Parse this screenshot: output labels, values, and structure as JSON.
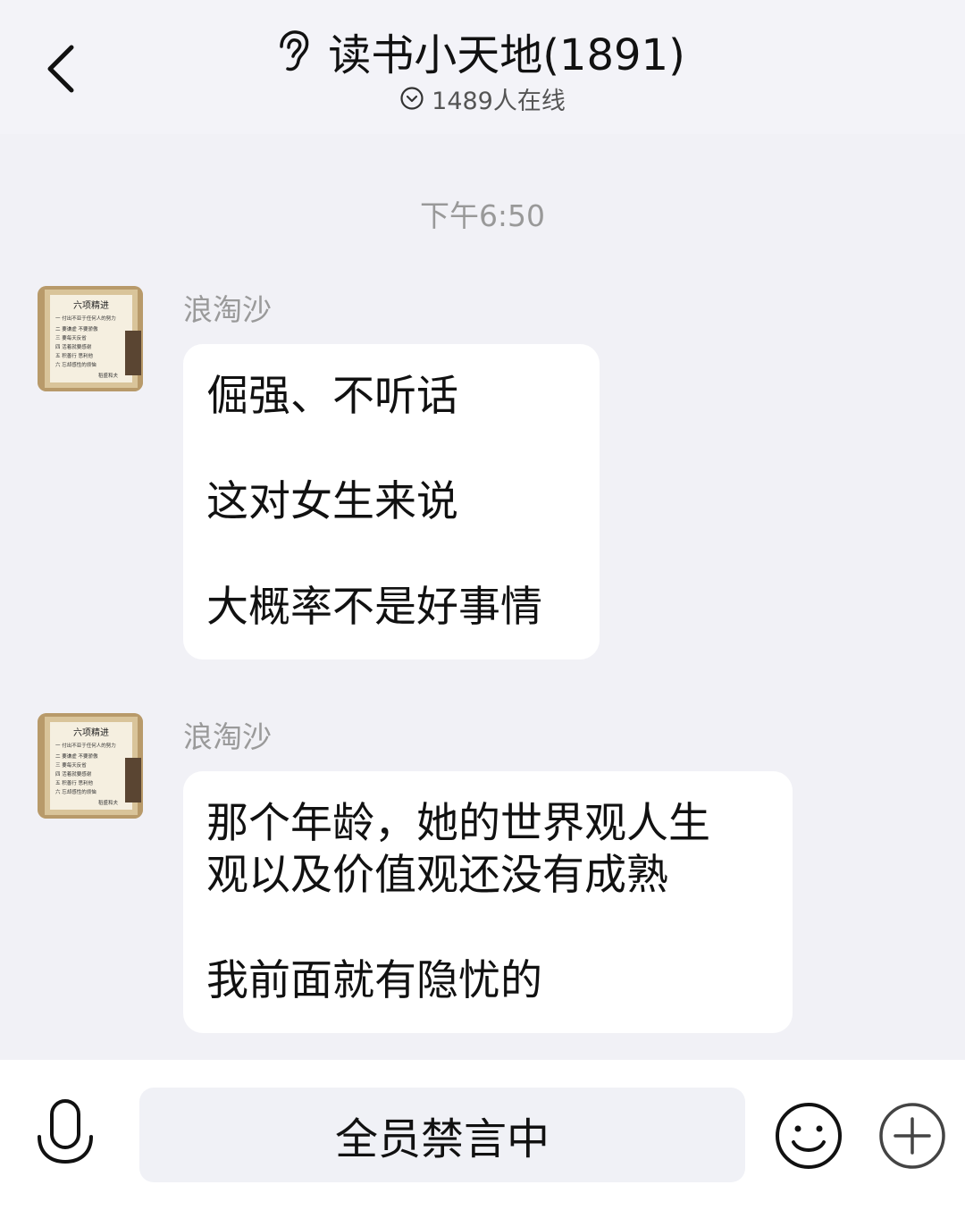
{
  "header": {
    "back_icon": "chevron-left-icon",
    "group_icon": "ear-icon",
    "title": "读书小天地(1891)",
    "online_icon": "chevron-down-circle-icon",
    "online_text": "1489人在线"
  },
  "chat": {
    "timestamp": "下午6:50",
    "messages": [
      {
        "sender": "浪淘沙",
        "lines": [
          "倔强、不听话",
          "这对女生来说",
          "大概率不是好事情"
        ]
      },
      {
        "sender": "浪淘沙",
        "lines": [
          "那个年龄，她的世界观人生",
          "观以及价值观还没有成熟",
          "我前面就有隐忧的"
        ]
      }
    ],
    "avatar_image_text": {
      "title": "六项精进",
      "items": [
        "一 付出不亚于任何人的努力",
        "二 要谦虚 不要骄傲",
        "三 要每天反省",
        "四 活着就要感谢",
        "五 积善行 思利他",
        "六 忘却感性的烦恼"
      ],
      "signature": "稻盛和夫"
    }
  },
  "bottom_bar": {
    "voice_icon": "microphone-icon",
    "mute_text": "全员禁言中",
    "emoji_icon": "smiley-icon",
    "plus_icon": "plus-circle-icon"
  },
  "colors": {
    "background": "#f1f1f6",
    "bubble": "#ffffff",
    "secondary_text": "#999999"
  }
}
